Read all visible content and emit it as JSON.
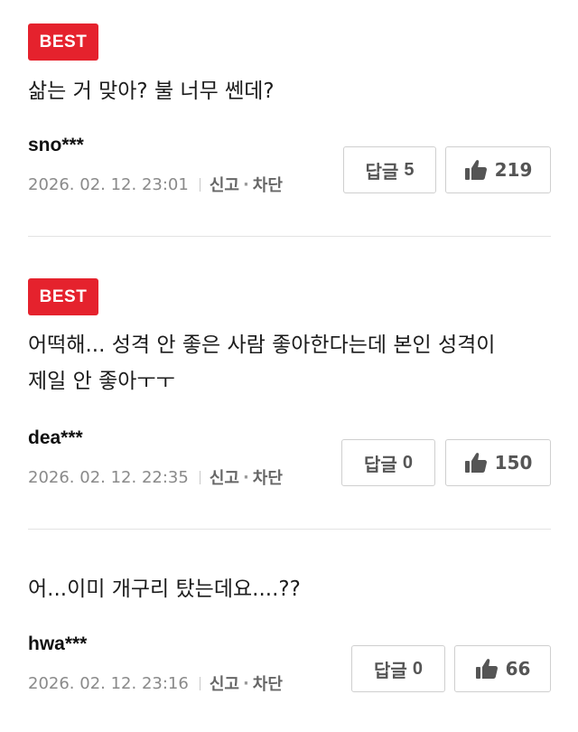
{
  "comments": [
    {
      "badge": "BEST",
      "text": "삶는 거 맞아? 불 너무 쎈데?",
      "user": "sno***",
      "datetime": "2026. 02. 12. 23:01",
      "report_label": "신고",
      "block_label": "차단",
      "reply_label": "답글",
      "reply_count": "5",
      "like_count": "219"
    },
    {
      "badge": "BEST",
      "text": "어떡해... 성격 안 좋은 사람 좋아한다는데 본인 성격이\n제일 안 좋아ㅜㅜ",
      "user": "dea***",
      "datetime": "2026. 02. 12. 22:35",
      "report_label": "신고",
      "block_label": "차단",
      "reply_label": "답글",
      "reply_count": "0",
      "like_count": "150"
    },
    {
      "text": "어...이미 개구리 탔는데요....??",
      "user": "hwa***",
      "datetime": "2026. 02. 12. 23:16",
      "report_label": "신고",
      "block_label": "차단",
      "reply_label": "답글",
      "reply_count": "0",
      "like_count": "66"
    }
  ],
  "icons": {
    "like": "thumbs-up-icon"
  },
  "colors": {
    "best_badge": "#e5222d",
    "meta_text": "#8a8a8a",
    "button_border": "#cfcfcf"
  }
}
